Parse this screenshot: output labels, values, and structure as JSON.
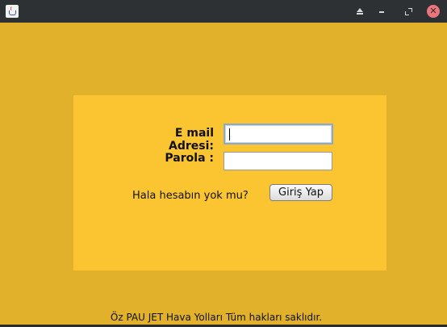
{
  "titlebar": {
    "buttons": [
      "eject-icon",
      "minimize-icon",
      "maximize-icon",
      "close-icon"
    ]
  },
  "form": {
    "email_label": "E mail Adresi:",
    "password_label": "Parola :",
    "email_value": "",
    "password_value": "",
    "no_account_text": "Hala hesabın yok mu?",
    "login_button": "Giriş Yap"
  },
  "footer": {
    "text": "Öz PAU JET Hava Yolları Tüm hakları saklıdır."
  },
  "colors": {
    "background": "#e1b12c",
    "panel": "#fbc531",
    "titlebar": "#2e3133",
    "close_button": "#e8767c"
  }
}
